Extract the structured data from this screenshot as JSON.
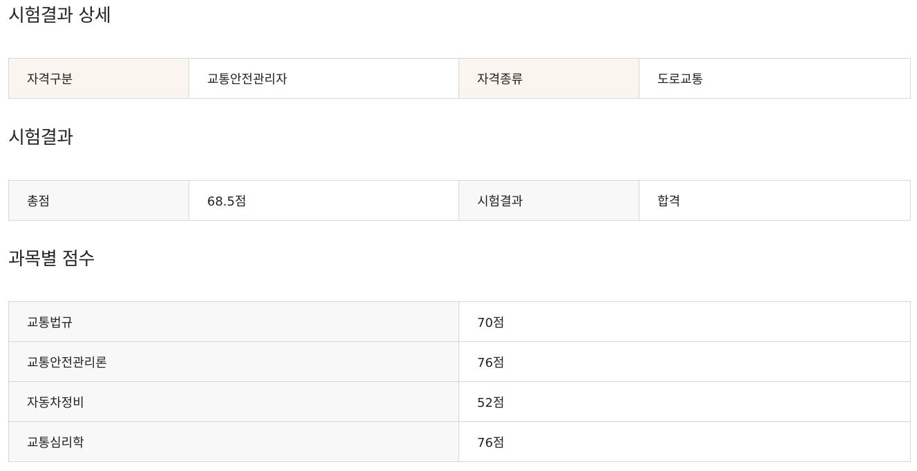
{
  "sections": {
    "detail_title": "시험결과 상세",
    "result_title": "시험결과",
    "subject_title": "과목별 점수"
  },
  "qualification": {
    "category_label": "자격구분",
    "category_value": "교통안전관리자",
    "type_label": "자격종류",
    "type_value": "도로교통"
  },
  "result": {
    "total_label": "총점",
    "total_value": "68.5점",
    "result_label": "시험결과",
    "result_value": "합격"
  },
  "subjects": [
    {
      "name": "교통법규",
      "score": "70점"
    },
    {
      "name": "교통안전관리론",
      "score": "76점"
    },
    {
      "name": "자동차정비",
      "score": "52점"
    },
    {
      "name": "교통심리학",
      "score": "76점"
    }
  ],
  "colors": {
    "header_beige": "#faf5ef",
    "header_gray": "#f8f8f8",
    "border": "#d6d6d6"
  }
}
